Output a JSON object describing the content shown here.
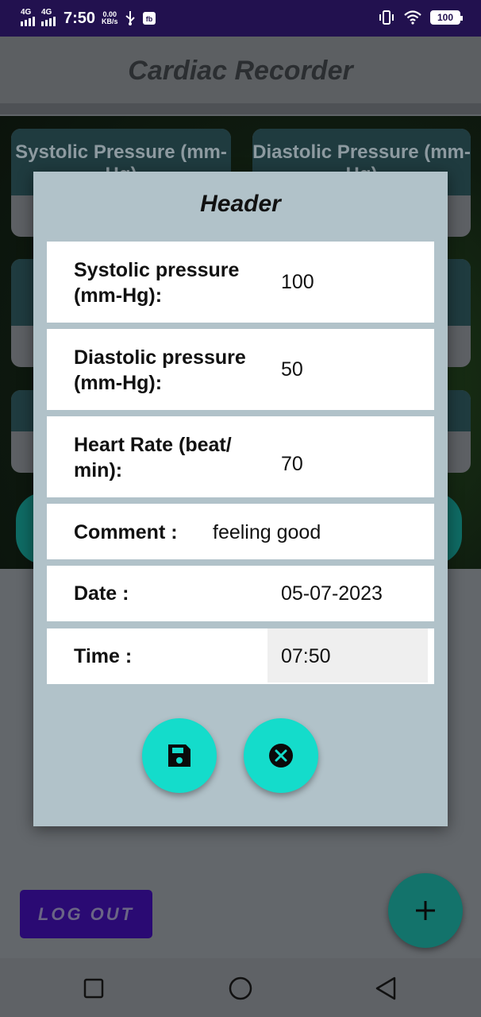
{
  "status_bar": {
    "network_1": "4G",
    "network_2": "4G",
    "time": "7:50",
    "speed_value": "0.00",
    "speed_unit": "KB/s",
    "battery": "100"
  },
  "app_bar": {
    "title": "Cardiac Recorder"
  },
  "background_cards": {
    "systolic_title": "Systolic Pressure (mm-Hg)",
    "diastolic_title": "Diastolic Pressure (mm-Hg)"
  },
  "dialog": {
    "title": "Header",
    "rows": [
      {
        "label": "Systolic pressure (mm-Hg):",
        "value": "100"
      },
      {
        "label": "Diastolic pressure (mm-Hg):",
        "value": "50"
      },
      {
        "label": "Heart Rate (beat/ min):",
        "value": "70"
      },
      {
        "label": "Comment :",
        "value": "feeling good"
      },
      {
        "label": "Date :",
        "value": "05-07-2023"
      },
      {
        "label": "Time :",
        "value": "07:50"
      }
    ],
    "save_icon": "save-icon",
    "cancel_icon": "cancel-icon"
  },
  "actions": {
    "logout_label": "LOG OUT",
    "add_icon": "plus-icon"
  },
  "colors": {
    "status_bar": "#22114f",
    "dialog_bg": "#b1c2c9",
    "dialog_button": "#14dccb",
    "logout_bg": "#2a0a73",
    "fab": "#13736b"
  }
}
